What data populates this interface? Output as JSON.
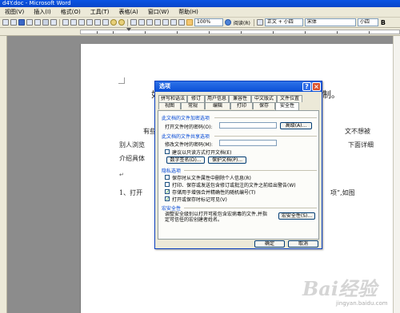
{
  "window": {
    "title": "d4Y.doc - Microsoft Word"
  },
  "menubar": {
    "items": [
      "视图(V)",
      "插入(I)",
      "格式(O)",
      "工具(T)",
      "表格(A)",
      "窗口(W)",
      "帮助(H)"
    ]
  },
  "toolbar": {
    "zoom": "100%",
    "reading_label": "阅读(R)",
    "style": "正文 + 小四",
    "font": "宋体",
    "size": "小四",
    "bold": "B"
  },
  "document": {
    "line1": "如",
    "line1_tail": "制。",
    "line2_head": "有些",
    "line2_tail": "文不想被",
    "line3_head": "别人浏览",
    "line3_tail": "下面详细",
    "line4": "介绍具体",
    "item1_head": "1、打开",
    "item1_tail": "项”,如图",
    "return_mark": "↵"
  },
  "dialog": {
    "title": "选项",
    "help_glyph": "?",
    "close_glyph": "×",
    "tabs_row1": [
      "拼写和语法",
      "修订",
      "用户信息",
      "兼容性",
      "中文版式",
      "文件位置"
    ],
    "tabs_row2": [
      "视图",
      "常规",
      "编辑",
      "打印",
      "保存",
      "安全性"
    ],
    "encrypt_section": "此文档的文件加密选项",
    "open_password_label": "打开文件时的密码(O):",
    "advanced_button": "高级(A)...",
    "share_section": "此文档的文件共享选项",
    "modify_password_label": "修改文件时的密码(M):",
    "readonly_check": "建议以只读方式打开文档(E)",
    "digital_sign_button": "数字签名(D)...",
    "protect_doc_button": "保护文档(P)...",
    "privacy_section": "隐私选项",
    "privacy_checks": [
      {
        "label": "保存时从文件属性中删除个人信息(R)",
        "checked": false
      },
      {
        "label": "打印、保存或发送包含修订或批注的文件之前给出警告(W)",
        "checked": false
      },
      {
        "label": "存储用于增强合并精确性的随机编号(T)",
        "checked": true
      },
      {
        "label": "打开或保存时标记可见(V)",
        "checked": true
      }
    ],
    "macro_section": "宏安全性",
    "macro_desc_line1": "调整安全级别以打开可能包含宏病毒的文件,并指",
    "macro_desc_line2": "定可信任的宏创建者姓名。",
    "macro_button": "宏安全性(S)...",
    "ok_button": "确定",
    "cancel_button": "取消"
  },
  "watermark": {
    "text": "Bai经验",
    "sub": "jingyan.baidu.com"
  },
  "colors": {
    "title_blue": "#0a54e3",
    "dialog_face": "#ece9d8",
    "section_blue": "#0046d5"
  }
}
